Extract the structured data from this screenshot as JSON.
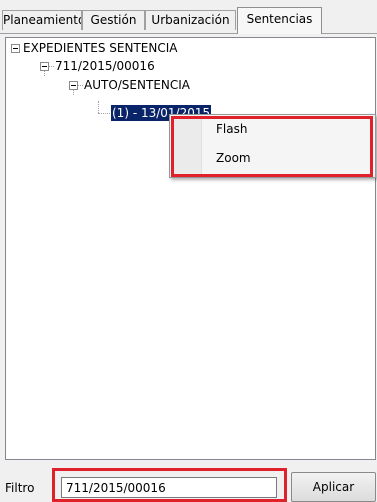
{
  "tabs": [
    {
      "label": "Planeamiento",
      "active": false
    },
    {
      "label": "Gestión",
      "active": false
    },
    {
      "label": "Urbanización",
      "active": false
    },
    {
      "label": "Sentencias",
      "active": true
    }
  ],
  "tree": {
    "root": {
      "label": "EXPEDIENTES SENTENCIA",
      "expanded": true
    },
    "level1": {
      "label": "711/2015/00016",
      "expanded": true
    },
    "level2": {
      "label": "AUTO/SENTENCIA",
      "expanded": true
    },
    "level3": {
      "label": "(1) - 13/01/2015",
      "selected": true
    }
  },
  "context_menu": {
    "items": [
      {
        "label": "Flash"
      },
      {
        "label": "Zoom"
      }
    ]
  },
  "filter": {
    "label": "Filtro",
    "value": "711/2015/00016"
  },
  "apply_button": {
    "label": "Aplicar"
  },
  "colors": {
    "selection_bg": "#0a246a",
    "annotation_red": "#e0202a"
  }
}
